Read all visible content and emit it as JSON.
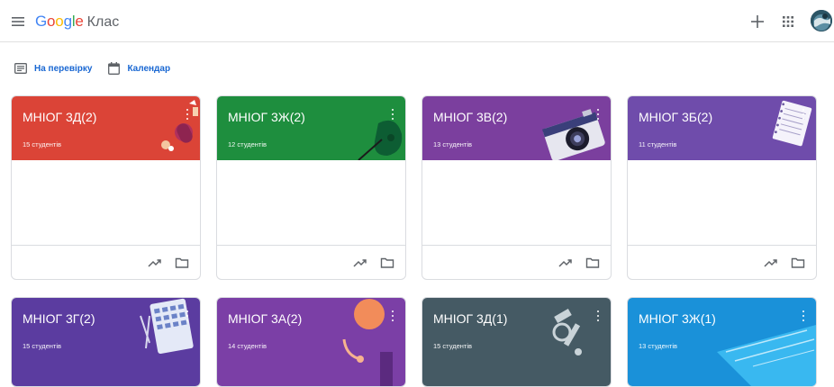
{
  "header": {
    "brand_google": [
      "G",
      "o",
      "o",
      "g",
      "l",
      "e"
    ],
    "brand_google_colors": [
      "#4285F4",
      "#EA4335",
      "#FBBC05",
      "#4285F4",
      "#34A853",
      "#EA4335"
    ],
    "brand_product": "Клас",
    "icons": {
      "menu": "menu-icon",
      "add": "plus-icon",
      "apps": "apps-grid-icon",
      "account": "avatar"
    }
  },
  "subnav": {
    "to_review": "На перевірку",
    "calendar": "Календар",
    "link_color": "#1967d2"
  },
  "classes": [
    {
      "name": "МНІОГ 3Д(2)",
      "students": "15 студентів",
      "color": "#db4437",
      "illustration": "cosmetics"
    },
    {
      "name": "МНІОГ 3Ж(2)",
      "students": "12 студентів",
      "color": "#1e8e3e",
      "illustration": "guitar"
    },
    {
      "name": "МНІОГ 3В(2)",
      "students": "13 студентів",
      "color": "#7b3f9e",
      "illustration": "camera"
    },
    {
      "name": "МНІОГ 3Б(2)",
      "students": "11 студентів",
      "color": "#6f4cab",
      "illustration": "notebook"
    },
    {
      "name": "МНІОГ 3Г(2)",
      "students": "15 студентів",
      "color": "#5b3ca0",
      "illustration": "calculator"
    },
    {
      "name": "МНІОГ 3А(2)",
      "students": "14 студентів",
      "color": "#7b3fa6",
      "illustration": "headphones"
    },
    {
      "name": "МНІОГ 3Д(1)",
      "students": "15 студентів",
      "color": "#455a64",
      "illustration": "bicycle-parts"
    },
    {
      "name": "МНІОГ 3Ж(1)",
      "students": "13 студентів",
      "color": "#1a91d9",
      "illustration": "swimming-pool"
    }
  ],
  "card_footer_icons": [
    "trending-icon",
    "folder-icon"
  ]
}
